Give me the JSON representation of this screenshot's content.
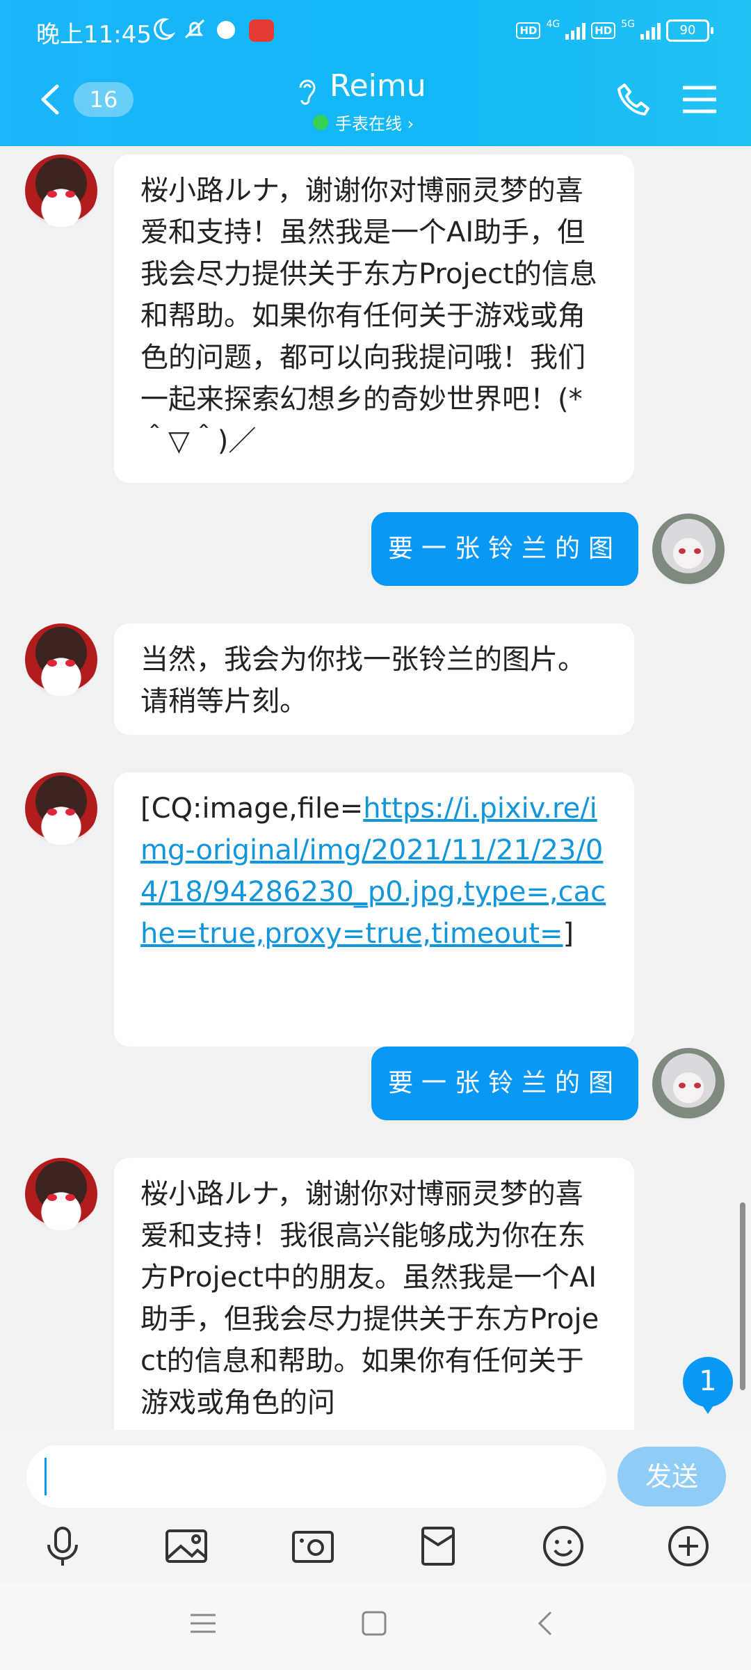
{
  "status_bar": {
    "time": "晚上11:45",
    "network_1": "4G",
    "network_2": "5G",
    "hd_label": "HD",
    "battery": "90"
  },
  "header": {
    "unread_count": "16",
    "title": "Reimu",
    "presence": "手表在线 ›",
    "colors": {
      "accent": "#12b8f6"
    }
  },
  "messages": [
    {
      "side": "left",
      "text": "桜小路ルナ，谢谢你对博丽灵梦的喜爱和支持！虽然我是一个AI助手，但我会尽力提供关于东方Project的信息和帮助。如果你有任何关于游戏或角色的问题，都可以向我提问哦！我们一起来探索幻想乡的奇妙世界吧！(*＾▽＾)／"
    },
    {
      "side": "right",
      "text": "要一张铃兰的图"
    },
    {
      "side": "left",
      "text": "当然，我会为你找一张铃兰的图片。请稍等片刻。"
    },
    {
      "side": "left",
      "prefix": "[CQ:image,file=",
      "link": "https://i.pixiv.re/img-original/img/2021/11/21/23/04/18/94286230_p0.jpg,type=,cache=true,proxy=true,timeout=",
      "suffix": "]"
    },
    {
      "side": "right",
      "text": "要一张铃兰的图"
    },
    {
      "side": "left",
      "text": "桜小路ルナ，谢谢你对博丽灵梦的喜爱和支持！我很高兴能够成为你在东方Project中的朋友。虽然我是一个AI助手，但我会尽力提供关于东方Project的信息和帮助。如果你有任何关于游戏或角色的问"
    }
  ],
  "new_message_badge": "1",
  "composer": {
    "input_value": "",
    "send_label": "发送"
  },
  "toolbar": {
    "icons": [
      "microphone-icon",
      "image-icon",
      "camera-icon",
      "red-packet-icon",
      "emoji-icon",
      "plus-icon"
    ]
  },
  "system_nav": {
    "icons": [
      "menu-nav-icon",
      "home-nav-icon",
      "back-nav-icon"
    ]
  }
}
